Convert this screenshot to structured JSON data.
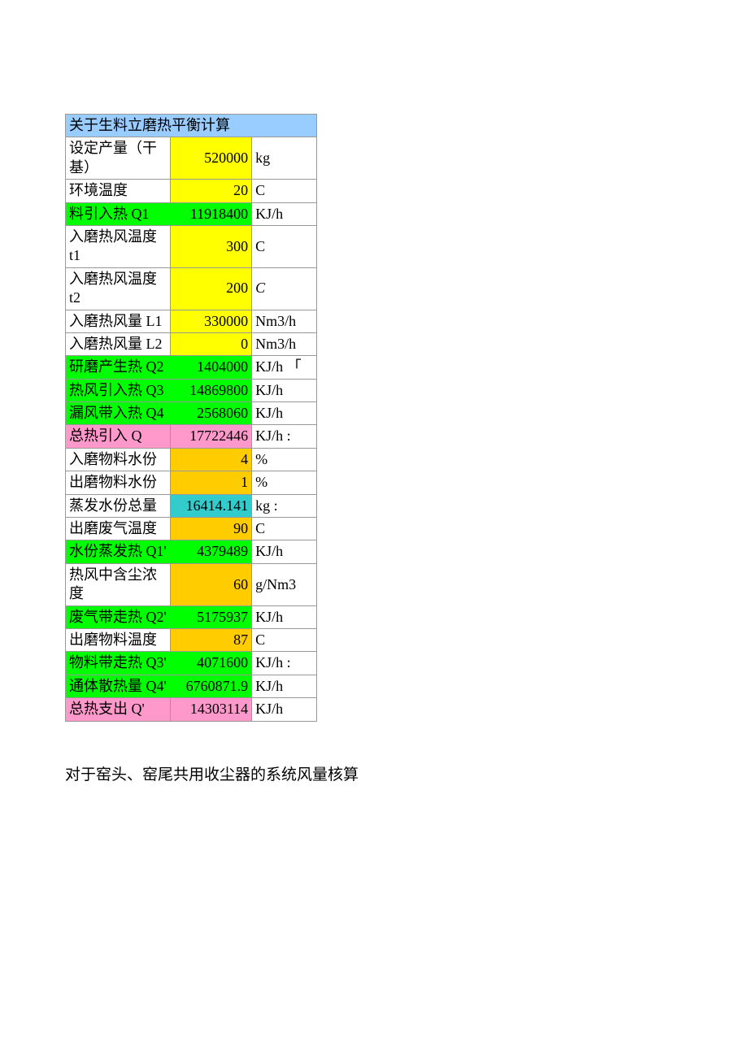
{
  "title": "关于生料立磨热平衡计算",
  "rows": [
    {
      "label": "设定产量（干基）",
      "value": "520000",
      "unit": "kg",
      "labelCls": "bg-white",
      "valueCls": "bg-yellow",
      "unitCls": ""
    },
    {
      "label": "环境温度",
      "value": "20",
      "unit": "C",
      "labelCls": "bg-white",
      "valueCls": "bg-yellow",
      "unitCls": "serif-c"
    },
    {
      "label": "料引入热 Q1",
      "value": "11918400",
      "unit": "KJ/h",
      "labelCls": "bg-green",
      "valueCls": "bg-green-r",
      "unitCls": ""
    },
    {
      "label": "入磨热风温度 t1",
      "value": "300",
      "unit": "C",
      "labelCls": "bg-white",
      "valueCls": "bg-yellow",
      "unitCls": "serif-c"
    },
    {
      "label": "入磨热风温度 t2",
      "value": "200",
      "unit": "C",
      "labelCls": "bg-white",
      "valueCls": "bg-yellow",
      "unitCls": "italic-serif"
    },
    {
      "label": "入磨热风量 L1",
      "value": "330000",
      "unit": "Nm3/h",
      "labelCls": "bg-white",
      "valueCls": "bg-yellow",
      "unitCls": ""
    },
    {
      "label": "入磨热风量 L2",
      "value": "0",
      "unit": "Nm3/h",
      "labelCls": "bg-white",
      "valueCls": "bg-yellow",
      "unitCls": ""
    },
    {
      "label": "研磨产生热 Q2",
      "value": "1404000",
      "unit": "KJ/h 「",
      "labelCls": "bg-green",
      "valueCls": "bg-green-r",
      "unitCls": ""
    },
    {
      "label": "热风引入热 Q3",
      "value": "14869800",
      "unit": "KJ/h",
      "labelCls": "bg-green",
      "valueCls": "bg-green-r",
      "unitCls": ""
    },
    {
      "label": "漏风带入热 Q4",
      "value": "2568060",
      "unit": "KJ/h",
      "labelCls": "bg-green",
      "valueCls": "bg-green-r",
      "unitCls": ""
    },
    {
      "label": "总热引入 Q",
      "value": "17722446",
      "unit": "KJ/h :",
      "labelCls": "bg-pink",
      "valueCls": "bg-pink-r",
      "unitCls": ""
    },
    {
      "label": "入磨物料水份",
      "value": "4",
      "unit": "%",
      "labelCls": "bg-white",
      "valueCls": "bg-orange",
      "unitCls": ""
    },
    {
      "label": "出磨物料水份",
      "value": "1",
      "unit": "%",
      "labelCls": "bg-white",
      "valueCls": "bg-orange",
      "unitCls": ""
    },
    {
      "label": "蒸发水份总量",
      "value": "16414.141",
      "unit": "kg       :",
      "labelCls": "bg-white",
      "valueCls": "bg-cyan",
      "unitCls": ""
    },
    {
      "label": "出磨废气温度",
      "value": "90",
      "unit": "C",
      "labelCls": "bg-white",
      "valueCls": "bg-orange",
      "unitCls": "serif-c"
    },
    {
      "label": "水份蒸发热 Q1'",
      "value": "4379489",
      "unit": "KJ/h",
      "labelCls": "bg-green",
      "valueCls": "bg-green-r",
      "unitCls": ""
    },
    {
      "label": "热风中含尘浓度",
      "value": "60",
      "unit": "g/Nm3",
      "labelCls": "bg-white",
      "valueCls": "bg-orange",
      "unitCls": ""
    },
    {
      "label": "废气带走热 Q2'",
      "value": "5175937",
      "unit": "KJ/h",
      "labelCls": "bg-green",
      "valueCls": "bg-green-r",
      "unitCls": ""
    },
    {
      "label": "出磨物料温度",
      "value": "87",
      "unit": "C",
      "labelCls": "bg-white",
      "valueCls": "bg-orange",
      "unitCls": "serif-c"
    },
    {
      "label": "物料带走热 Q3'",
      "value": "4071600",
      "unit": "KJ/h     :",
      "labelCls": "bg-green",
      "valueCls": "bg-green-r",
      "unitCls": ""
    },
    {
      "label": "通体散热量 Q4'",
      "value": "6760871.9",
      "unit": "KJ/h",
      "labelCls": "bg-green",
      "valueCls": "bg-green-r",
      "unitCls": ""
    },
    {
      "label": "总热支出 Q'",
      "value": "14303114",
      "unit": "KJ/h",
      "labelCls": "bg-pink",
      "valueCls": "bg-pink-r",
      "unitCls": ""
    }
  ],
  "footer": "对于窑头、窑尾共用收尘器的系统风量核算"
}
